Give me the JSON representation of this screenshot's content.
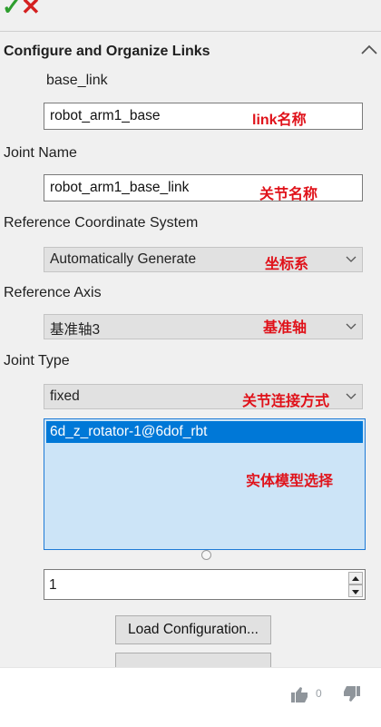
{
  "toolbar": {
    "ok_glyph": "✓",
    "cancel_glyph": "✕"
  },
  "section": {
    "title": "Configure and Organize Links"
  },
  "link": {
    "label": "base_link",
    "name_value": "robot_arm1_base",
    "annotation": "link名称"
  },
  "joint": {
    "label": "Joint Name",
    "name_value": "robot_arm1_base_link",
    "annotation": "关节名称"
  },
  "coord": {
    "label": "Reference Coordinate System",
    "selected": "Automatically Generate",
    "annotation": "坐标系"
  },
  "axis": {
    "label": "Reference Axis",
    "selected": "基准轴3",
    "annotation": "基准轴"
  },
  "joint_type": {
    "label": "Joint Type",
    "selected": "fixed",
    "annotation": "关节连接方式"
  },
  "entities": {
    "items": [
      "6d_z_rotator-1@6dof_rbt"
    ],
    "annotation": "实体模型选择"
  },
  "count": {
    "value": "1"
  },
  "buttons": {
    "load": "Load Configuration..."
  },
  "footer": {
    "likes": "0"
  },
  "colors": {
    "accent": "#0078d7",
    "annotation": "#e0121a",
    "ok": "#2e9e2e",
    "cancel": "#d42020"
  }
}
